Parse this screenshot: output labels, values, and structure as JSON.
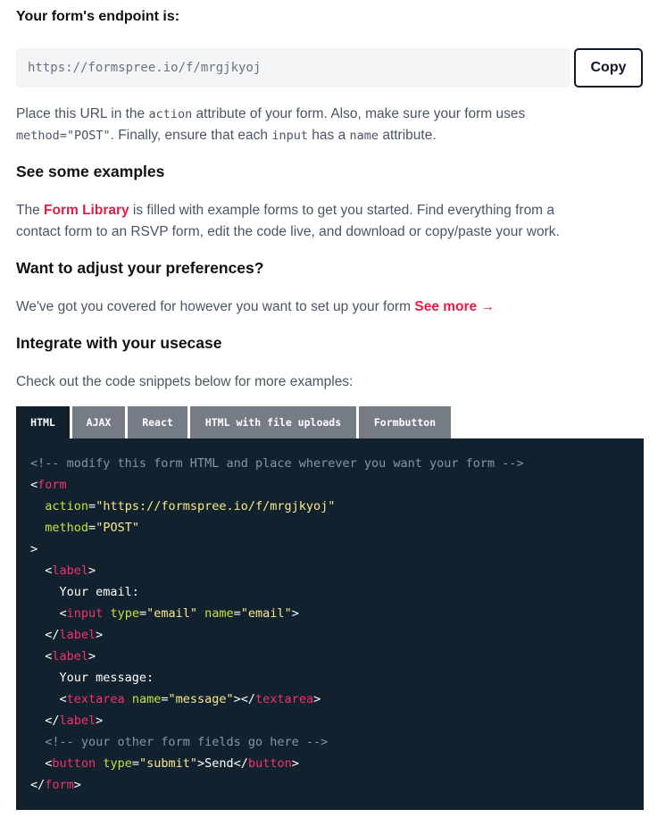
{
  "endpoint": {
    "heading": "Your form's endpoint is:",
    "url": "https://formspree.io/f/mrgjkyoj",
    "copy_label": "Copy"
  },
  "instructions": {
    "t1": "Place this URL in the ",
    "c1": "action",
    "t2": " attribute of your form. Also, make sure your form uses",
    "c2": "method=\"POST\"",
    "t3": ". Finally, ensure that each ",
    "c3": "input",
    "t4": " has a ",
    "c4": "name",
    "t5": " attribute."
  },
  "examples": {
    "heading": "See some examples",
    "t1": "The ",
    "link": "Form Library",
    "t2": " is filled with example forms to get you started. Find everything from a",
    "t3": "contact form to an RSVP form, edit the code live, and download or copy/paste your work."
  },
  "preferences": {
    "heading": "Want to adjust your preferences?",
    "text": "We've got you covered for however you want to set up your form ",
    "link": "See more →"
  },
  "integrate": {
    "heading": "Integrate with your usecase",
    "text": "Check out the code snippets below for more examples:"
  },
  "tabs": [
    {
      "label": "HTML",
      "active": true
    },
    {
      "label": "AJAX",
      "active": false
    },
    {
      "label": "React",
      "active": false
    },
    {
      "label": "HTML with file uploads",
      "active": false
    },
    {
      "label": "Formbutton",
      "active": false
    }
  ],
  "code": {
    "comment1": "<!-- modify this form HTML and place wherever you want your form -->",
    "lt": "<",
    "gt": ">",
    "close_lt": "</",
    "eq": "=",
    "form": "form",
    "action_attr": "action",
    "action_val": "\"https://formspree.io/f/mrgjkyoj\"",
    "method_attr": "method",
    "method_val": "\"POST\"",
    "label": "label",
    "your_email": "Your email:",
    "input": "input",
    "type_attr": "type",
    "email_val": "\"email\"",
    "name_attr": "name",
    "your_message": "Your message:",
    "textarea": "textarea",
    "message_val": "\"message\"",
    "comment2": "<!-- your other form fields go here -->",
    "button": "button",
    "submit_val": "\"submit\"",
    "send": "Send"
  }
}
